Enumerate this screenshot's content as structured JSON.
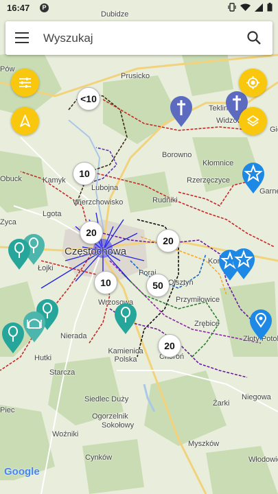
{
  "status_bar": {
    "time": "16:47",
    "app_glyph": "P"
  },
  "search": {
    "placeholder": "Wyszukaj"
  },
  "buttons": {
    "filters": "filters-icon",
    "navigate": "navigation-arrow-icon",
    "locate": "my-location-icon",
    "layers": "layers-icon"
  },
  "clusters": [
    "<10",
    "10",
    "20",
    "20",
    "10",
    "50",
    "20"
  ],
  "places": [
    "Dubidze",
    "Prusicko",
    "Teklino",
    "Widzów",
    "Gid",
    "Borowno",
    "Kłomnice",
    "Rzerzęczyce",
    "Garnek",
    "Kamyk",
    "Lubojna",
    "Wierzchowisko",
    "Rudniki",
    "Obuck",
    "Lgota",
    "Częstochowa",
    "Łojki",
    "Kon",
    "Wrzosowa",
    "Olsztyn",
    "Przymiłowice",
    "Zrębice",
    "Nierada",
    "Hutki",
    "Starcza",
    "Kamienica Polska",
    "Choroń",
    "Złoty Potok",
    "Siedlec Duży",
    "Żarki",
    "Ogorzelnik",
    "Sokołowy",
    "Woźniki",
    "Cynków",
    "Myszków",
    "Włodowice",
    "Niegowa",
    "Pów",
    "Zyca",
    "Poraj",
    "Piec"
  ],
  "attribution": "Google",
  "brand_colors": {
    "fab": "#f9c80e",
    "pin_blue": "#1e88e5",
    "pin_purple": "#5c6bc0",
    "pin_teal": "#26a69a"
  }
}
